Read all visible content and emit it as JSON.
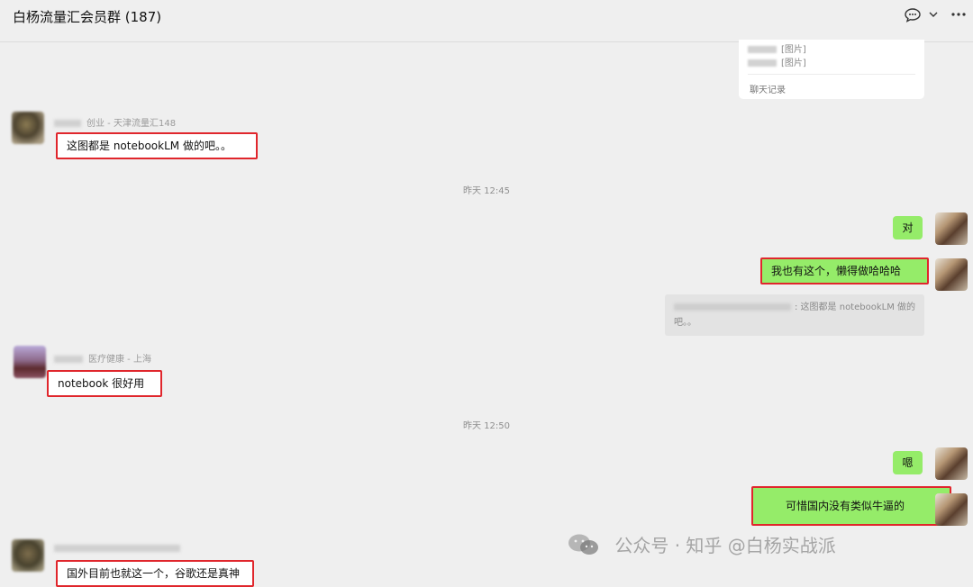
{
  "header": {
    "title": "白杨流量汇会员群 (187)",
    "icons": [
      "chat-bubble-icon",
      "chevron-down-icon",
      "more-icon"
    ]
  },
  "forwarded_card": {
    "lines": [
      "[图片]",
      "[图片]"
    ],
    "label": "聊天记录"
  },
  "messages": [
    {
      "sender_tag": "创业 - 天津流量汇148",
      "text": "这图都是 notebookLM 做的吧。。"
    },
    {
      "time": "昨天 12:45"
    },
    {
      "text": "对"
    },
    {
      "text": "我也有这个，懒得做哈哈哈"
    },
    {
      "quote": ": 这图都是 notebookLM 做的吧。。"
    },
    {
      "sender_tag": "医疗健康 - 上海",
      "text": "notebook 很好用"
    },
    {
      "time": "昨天 12:50"
    },
    {
      "text": "嗯"
    },
    {
      "text": "可惜国内没有类似牛逼的"
    },
    {
      "text": "国外目前也就这一个，谷歌还是真神"
    }
  ],
  "watermark": "公众号 · 知乎 @白杨实战派",
  "colors": {
    "self_bubble": "#95ec69",
    "highlight": "#e0262c",
    "background": "#efefef"
  }
}
